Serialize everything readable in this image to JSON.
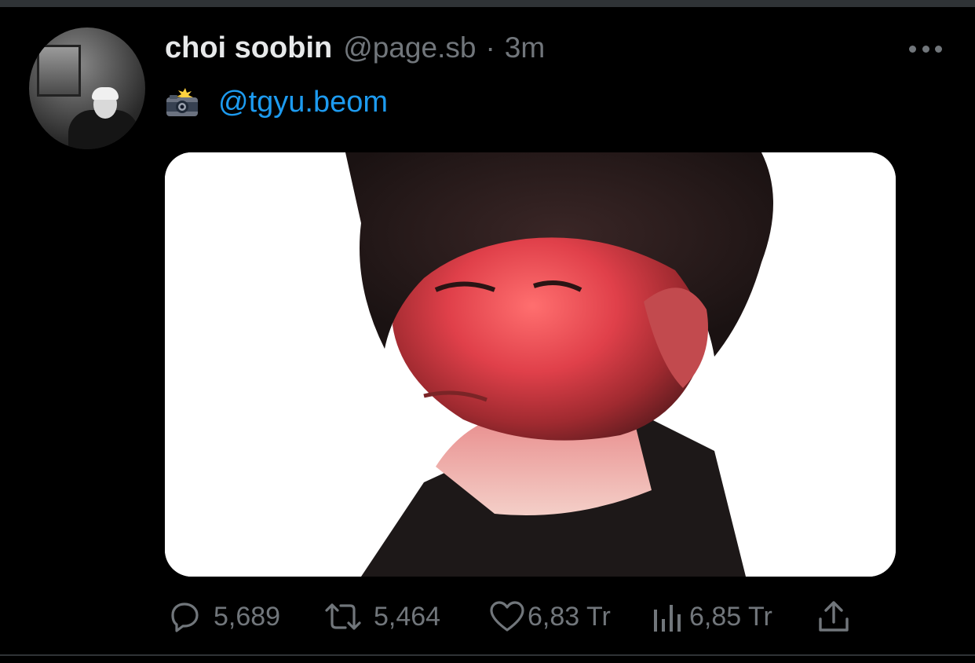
{
  "tweet": {
    "author_name": "choi soobin",
    "author_handle": "@page.sb",
    "separator": "·",
    "timestamp": "3m",
    "text_emoji": "camera-with-flash-icon",
    "mention": "@tgyu.beom"
  },
  "actions": {
    "replies": "5,689",
    "retweets": "5,464",
    "likes": "6,83 Tr",
    "views": "6,85 Tr"
  },
  "colors": {
    "background": "#000000",
    "divider": "#2f3336",
    "primary_text": "#e7e9ea",
    "secondary_text": "#71767b",
    "link": "#1d9bf0"
  },
  "icons": [
    "more-icon",
    "camera-with-flash-icon",
    "reply-icon",
    "retweet-icon",
    "like-icon",
    "views-icon",
    "share-icon"
  ]
}
